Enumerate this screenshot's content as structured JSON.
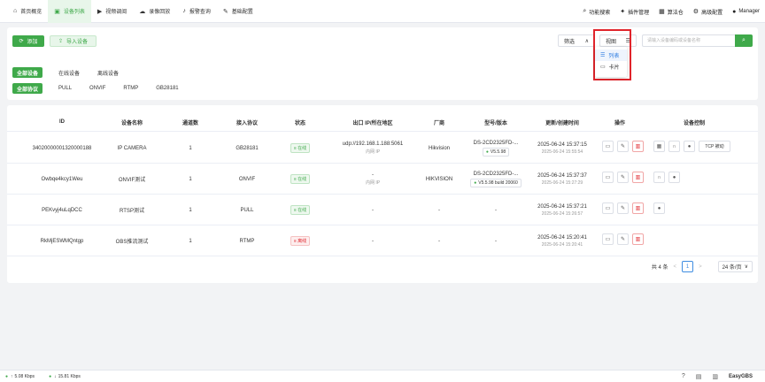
{
  "nav": {
    "items": [
      {
        "label": "首页概览",
        "icon": "home-icon",
        "glyph": "⌂"
      },
      {
        "label": "设备列表",
        "icon": "camera-icon",
        "glyph": "▣"
      },
      {
        "label": "视频调阅",
        "icon": "play-icon",
        "glyph": "▶"
      },
      {
        "label": "录像回放",
        "icon": "cloud-icon",
        "glyph": "☁"
      },
      {
        "label": "报警查询",
        "icon": "bell-icon",
        "glyph": "♪"
      },
      {
        "label": "基础配置",
        "icon": "pen-icon",
        "glyph": "✎"
      }
    ],
    "right": [
      {
        "label": "功能搜索",
        "icon": "search-icon",
        "glyph": "⌕"
      },
      {
        "label": "插件管理",
        "icon": "puzzle-icon",
        "glyph": "✦"
      },
      {
        "label": "算法仓",
        "icon": "chip-icon",
        "glyph": "▦"
      },
      {
        "label": "高级配置",
        "icon": "gear-icon",
        "glyph": "⚙"
      },
      {
        "label": "Manager",
        "icon": "user-icon",
        "glyph": "●"
      }
    ]
  },
  "toolbar": {
    "add_label": "添加",
    "import_label": "导入设备",
    "filter_label": "筛选",
    "view_label": "视图",
    "search_placeholder": "请输入设备编码或设备名称"
  },
  "view_menu": {
    "items": [
      {
        "label": "列表",
        "glyph": "☰"
      },
      {
        "label": "卡片",
        "glyph": "▭"
      }
    ]
  },
  "filters": {
    "status": [
      "全部设备",
      "在线设备",
      "离线设备"
    ],
    "protocol": [
      "全部协议",
      "PULL",
      "ONVIF",
      "RTMP",
      "GB28181"
    ]
  },
  "table": {
    "headers": [
      "ID",
      "设备名称",
      "通道数",
      "接入协议",
      "状态",
      "出口 IP/所在地区",
      "厂商",
      "型号/版本",
      "更新/创建时间",
      "操作",
      "设备控制"
    ],
    "rows": [
      {
        "id": "34020000001320000188",
        "name": "IP CAMERA",
        "channels": "1",
        "protocol": "GB28181",
        "status": "在线",
        "online": true,
        "ip": "udp://192.168.1.188:5061",
        "ip_sub": "内网 IP",
        "vendor": "Hikvision",
        "model": "DS-2CD2325FD-...",
        "version": "V5.5.98",
        "updated": "2025-06-24 15:37:15",
        "created": "2025-06-24 15:55:54",
        "control_text": "TCP 被动"
      },
      {
        "id": "Owbqe4kcy1Weu",
        "name": "ONVIF测试",
        "channels": "1",
        "protocol": "ONVIF",
        "status": "在线",
        "online": true,
        "ip": "-",
        "ip_sub": "内网 IP",
        "vendor": "HIKVISION",
        "model": "DS-2CD2325FD-...",
        "version": "V5.5.98 build 20060",
        "updated": "2025-06-24 15:37:37",
        "created": "2025-06-24 15:27:29"
      },
      {
        "id": "PEKvyj4uLqDCC",
        "name": "RTSP测试",
        "channels": "1",
        "protocol": "PULL",
        "status": "在线",
        "online": true,
        "ip": "-",
        "vendor": "-",
        "model": "-",
        "updated": "2025-06-24 15:37:21",
        "created": "2025-06-24 15:26:57"
      },
      {
        "id": "RkMjESWMQntgp",
        "name": "OBS推流测试",
        "channels": "1",
        "protocol": "RTMP",
        "status": "离线",
        "online": false,
        "ip": "-",
        "vendor": "-",
        "model": "-",
        "updated": "2025-06-24 15:20:41",
        "created": "2025-06-24 15:20:41"
      }
    ]
  },
  "pagination": {
    "total": "共 4 条",
    "current": "1",
    "prev": "<",
    "next": ">",
    "page_size": "24 条/页"
  },
  "statusbar": {
    "upload": "5.08 Kbps",
    "download": "15.81 Kbps",
    "brand": "EasyGBS"
  },
  "colors": {
    "accent": "#3fa94a",
    "danger": "#e0242b",
    "link": "#2f7de1"
  }
}
